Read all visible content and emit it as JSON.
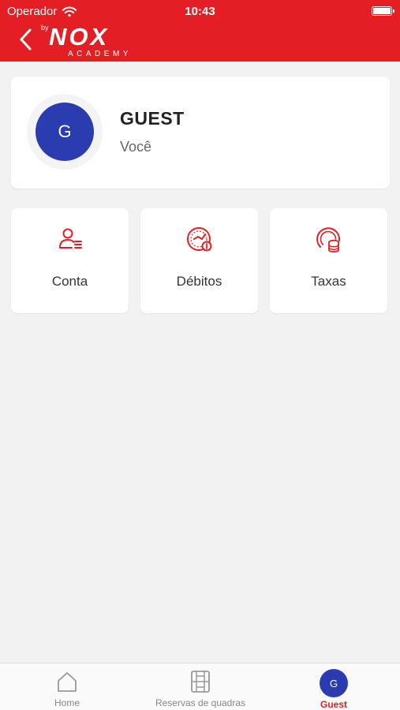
{
  "status_bar": {
    "carrier": "Operador",
    "time": "10:43"
  },
  "header": {
    "logo_by": "by",
    "logo_brand": "NOX",
    "logo_sub": "ACADEMY"
  },
  "profile": {
    "initial": "G",
    "name": "GUEST",
    "subtitle": "Você"
  },
  "tiles": [
    {
      "label": "Conta",
      "icon": "account-icon"
    },
    {
      "label": "Débitos",
      "icon": "debits-icon"
    },
    {
      "label": "Taxas",
      "icon": "fees-icon"
    }
  ],
  "tabbar": {
    "items": [
      {
        "label": "Home",
        "icon": "home-icon"
      },
      {
        "label": "Reservas de quadras",
        "icon": "court-icon"
      },
      {
        "label": "Guest",
        "initial": "G"
      }
    ],
    "active_index": 2
  },
  "colors": {
    "brand_red": "#e31e24",
    "avatar_blue": "#2b3bb0",
    "background": "#f2f2f2"
  }
}
